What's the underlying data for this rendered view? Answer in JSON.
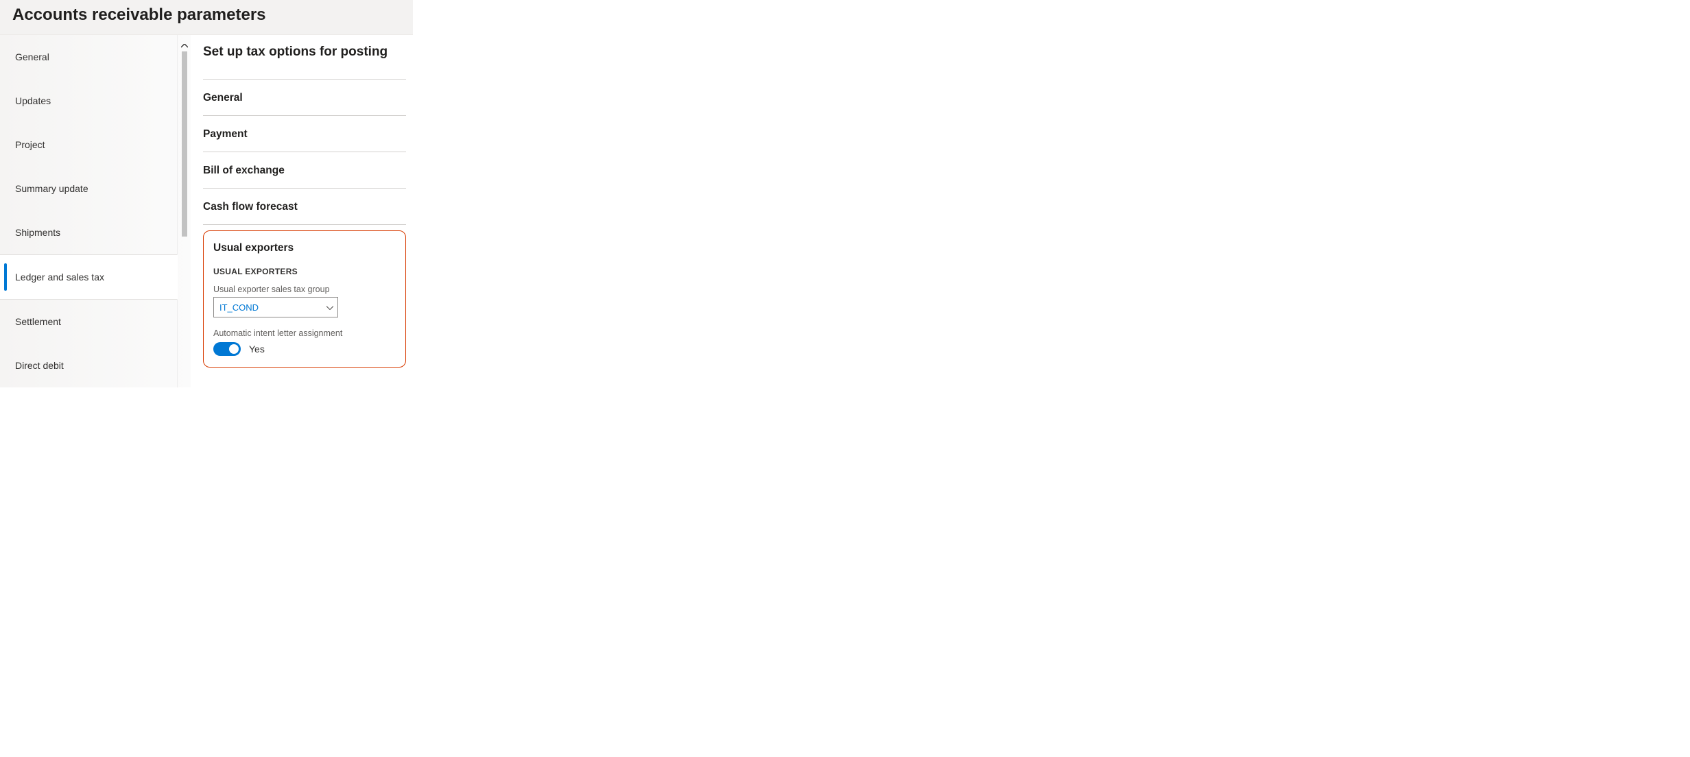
{
  "header": {
    "title": "Accounts receivable parameters"
  },
  "sidebar": {
    "items": [
      {
        "label": "General"
      },
      {
        "label": "Updates"
      },
      {
        "label": "Project"
      },
      {
        "label": "Summary update"
      },
      {
        "label": "Shipments"
      },
      {
        "label": "Ledger and sales tax"
      },
      {
        "label": "Settlement"
      },
      {
        "label": "Direct debit"
      }
    ],
    "active_index": 5
  },
  "main": {
    "title": "Set up tax options for posting",
    "sections": [
      {
        "label": "General"
      },
      {
        "label": "Payment"
      },
      {
        "label": "Bill of exchange"
      },
      {
        "label": "Cash flow forecast"
      }
    ],
    "usual_exporters": {
      "section_label": "Usual exporters",
      "group_label": "USUAL EXPORTERS",
      "tax_group_label": "Usual exporter sales tax group",
      "tax_group_value": "IT_COND",
      "auto_intent_label": "Automatic intent letter assignment",
      "auto_intent_value": "Yes"
    }
  }
}
